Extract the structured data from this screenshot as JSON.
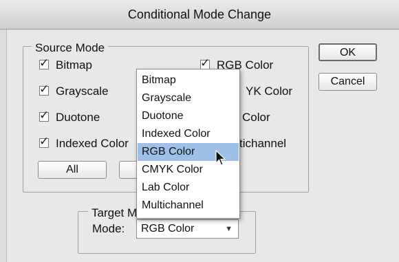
{
  "dialog": {
    "title": "Conditional Mode Change"
  },
  "source_mode": {
    "label": "Source Mode",
    "options": [
      {
        "label": "Bitmap",
        "checked": true
      },
      {
        "label": "Grayscale",
        "checked": true
      },
      {
        "label": "Duotone",
        "checked": true
      },
      {
        "label": "Indexed Color",
        "checked": true
      },
      {
        "label": "RGB Color",
        "checked": true
      },
      {
        "label": "YK Color",
        "checked": true
      },
      {
        "label": "Color",
        "checked": true
      },
      {
        "label": "tichannel",
        "checked": true
      }
    ],
    "all_label": "All"
  },
  "buttons": {
    "ok": "OK",
    "cancel": "Cancel"
  },
  "target_mode": {
    "label": "Target M",
    "mode_label": "Mode:",
    "selected": "RGB Color"
  },
  "dropdown": {
    "items": [
      "Bitmap",
      "Grayscale",
      "Duotone",
      "Indexed Color",
      "RGB Color",
      "CMYK Color",
      "Lab Color",
      "Multichannel"
    ],
    "highlighted": "RGB Color"
  },
  "icons": {
    "checkmark": "checkmark-icon",
    "arrow": "chevron-down-icon",
    "cursor": "mouse-pointer-icon"
  }
}
